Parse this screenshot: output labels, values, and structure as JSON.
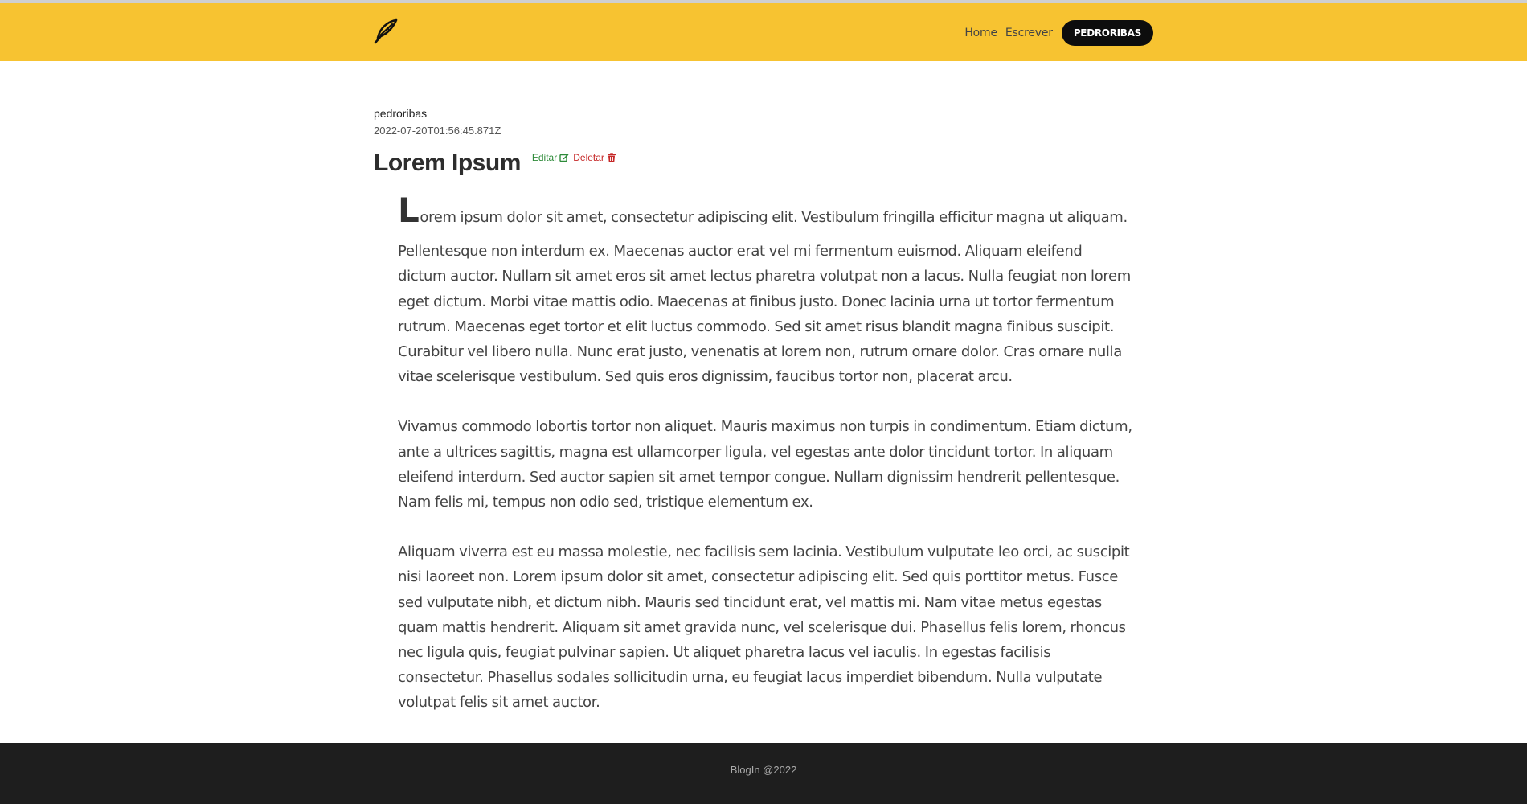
{
  "colors": {
    "header_bg": "#f7c331",
    "footer_bg": "#1e1e1e",
    "user_pill_bg": "#0d0d0d",
    "edit": "#2e8b3a",
    "delete": "#c62828"
  },
  "header": {
    "logo_icon": "feather-pen-icon",
    "nav": {
      "home": "Home",
      "write": "Escrever",
      "user": "PEDRORIBAS"
    }
  },
  "post": {
    "author": "pedroribas",
    "date": "2022-07-20T01:56:45.871Z",
    "title": "Lorem Ipsum",
    "actions": {
      "edit_label": "Editar",
      "edit_icon": "edit-icon",
      "delete_label": "Deletar",
      "delete_icon": "trash-icon"
    },
    "first_letter": "L",
    "first_line_rest": "orem ipsum dolor sit amet, consectetur adipiscing elit. Vestibulum fringilla efficitur magna ut aliquam.",
    "paragraphs": [
      "Pellentesque non interdum ex. Maecenas auctor erat vel mi fermentum euismod. Aliquam eleifend dictum auctor. Nullam sit amet eros sit amet lectus pharetra volutpat non a lacus. Nulla feugiat non lorem eget dictum. Morbi vitae mattis odio. Maecenas at finibus justo. Donec lacinia urna ut tortor fermentum rutrum. Maecenas eget tortor et elit luctus commodo. Sed sit amet risus blandit magna finibus suscipit. Curabitur vel libero nulla. Nunc erat justo, venenatis at lorem non, rutrum ornare dolor. Cras ornare nulla vitae scelerisque vestibulum. Sed quis eros dignissim, faucibus tortor non, placerat arcu.",
      "Vivamus commodo lobortis tortor non aliquet. Mauris maximus non turpis in condimentum. Etiam dictum, ante a ultrices sagittis, magna est ullamcorper ligula, vel egestas ante dolor tincidunt tortor. In aliquam eleifend interdum. Sed auctor sapien sit amet tempor congue. Nullam dignissim hendrerit pellentesque. Nam felis mi, tempus non odio sed, tristique elementum ex.",
      "Aliquam viverra est eu massa molestie, nec facilisis sem lacinia. Vestibulum vulputate leo orci, ac suscipit nisi laoreet non. Lorem ipsum dolor sit amet, consectetur adipiscing elit. Sed quis porttitor metus. Fusce sed vulputate nibh, et dictum nibh. Mauris sed tincidunt erat, vel mattis mi. Nam vitae metus egestas quam mattis hendrerit. Aliquam sit amet gravida nunc, vel scelerisque dui. Phasellus felis lorem, rhoncus nec ligula quis, feugiat pulvinar sapien. Ut aliquet pharetra lacus vel iaculis. In egestas facilisis consectetur. Phasellus sodales sollicitudin urna, eu feugiat lacus imperdiet bibendum. Nulla vulputate volutpat felis sit amet auctor."
    ]
  },
  "footer": {
    "text": "BlogIn @2022"
  }
}
